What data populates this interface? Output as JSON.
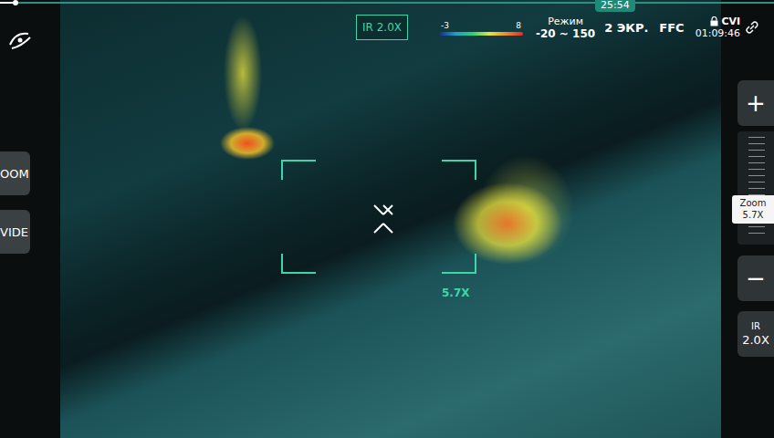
{
  "progress": {
    "level": 0.02,
    "time": "25:54"
  },
  "side_buttons": [
    {
      "label": "OOM"
    },
    {
      "label": "VIDE"
    }
  ],
  "hud": {
    "ir_badge": "IR 2.0X",
    "palette": {
      "min": "-3",
      "max": "8"
    },
    "mode": {
      "label": "Режим",
      "range": "-20 ~ 150"
    },
    "screen_button": "2 ЭКР.",
    "ffc_button": "FFC",
    "recorder": {
      "label": "CVI",
      "time": "01:09:46"
    }
  },
  "reticle": {
    "zoom": "5.7X"
  },
  "zoom_controls": {
    "plus": "+",
    "minus": "−",
    "level": 0.3,
    "tooltip_title": "Zoom",
    "tooltip_value": "5.7X"
  },
  "ir_zoom": {
    "label": "IR",
    "value": "2.0X"
  }
}
